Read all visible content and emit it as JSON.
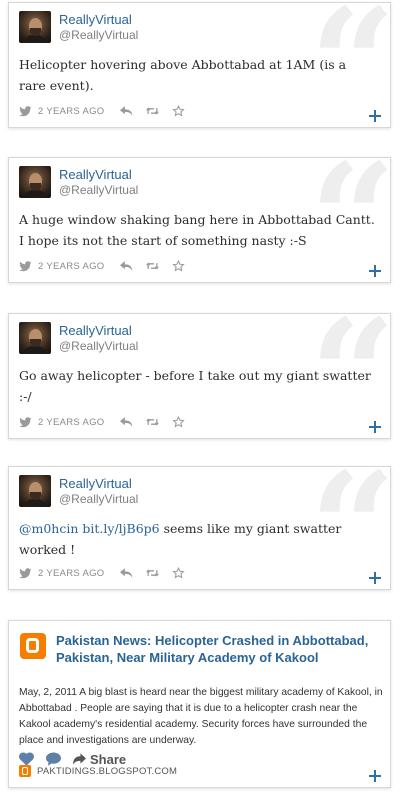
{
  "tweets": [
    {
      "name": "ReallyVirtual",
      "handle": "@ReallyVirtual",
      "text": "Helicopter hovering above Abbottabad at 1AM (is a rare event).",
      "time": "2 YEARS AGO"
    },
    {
      "name": "ReallyVirtual",
      "handle": "@ReallyVirtual",
      "text": "A huge window shaking bang here in Abbottabad Cantt. I hope its not the start of something nasty :-S",
      "time": "2 YEARS AGO"
    },
    {
      "name": "ReallyVirtual",
      "handle": "@ReallyVirtual",
      "text": "Go away helicopter - before I take out my giant swatter :-/",
      "time": "2 YEARS AGO"
    },
    {
      "name": "ReallyVirtual",
      "handle": "@ReallyVirtual",
      "mention": "@m0hcin",
      "link": "bit.ly/ljB6p6",
      "text_rest": " seems like my giant swatter worked !",
      "time": "2 YEARS AGO"
    }
  ],
  "blog_card": {
    "title": "Pakistan News: Helicopter Crashed in Abbottabad, Pakistan, Near Military Academy of Kakool",
    "body": "May, 2, 2011 A big blast is heard near the biggest military academy of Kakool, in Abbottabad . People are saying that it is due to a helicopter crash near the Kakool academy's residential academy. Security forces have surrounded the place and investigations are underway.",
    "share_label": "Share",
    "source": "PAKTIDINGS.BLOGSPOT.COM"
  },
  "colors": {
    "link_blue": "#2a6496",
    "blogger_orange": "#f57d00",
    "icon_gray": "#9a9a9a",
    "plus_blue": "#2f6fa8"
  },
  "icons": {
    "card": "double-quote-icon",
    "footer": [
      "bird-icon",
      "reply-icon",
      "retweet-icon",
      "favorite-star-icon",
      "expand-plus-icon"
    ],
    "blog_actions": [
      "like-heart-icon",
      "comment-bubble-icon",
      "share-arrow-icon"
    ]
  }
}
